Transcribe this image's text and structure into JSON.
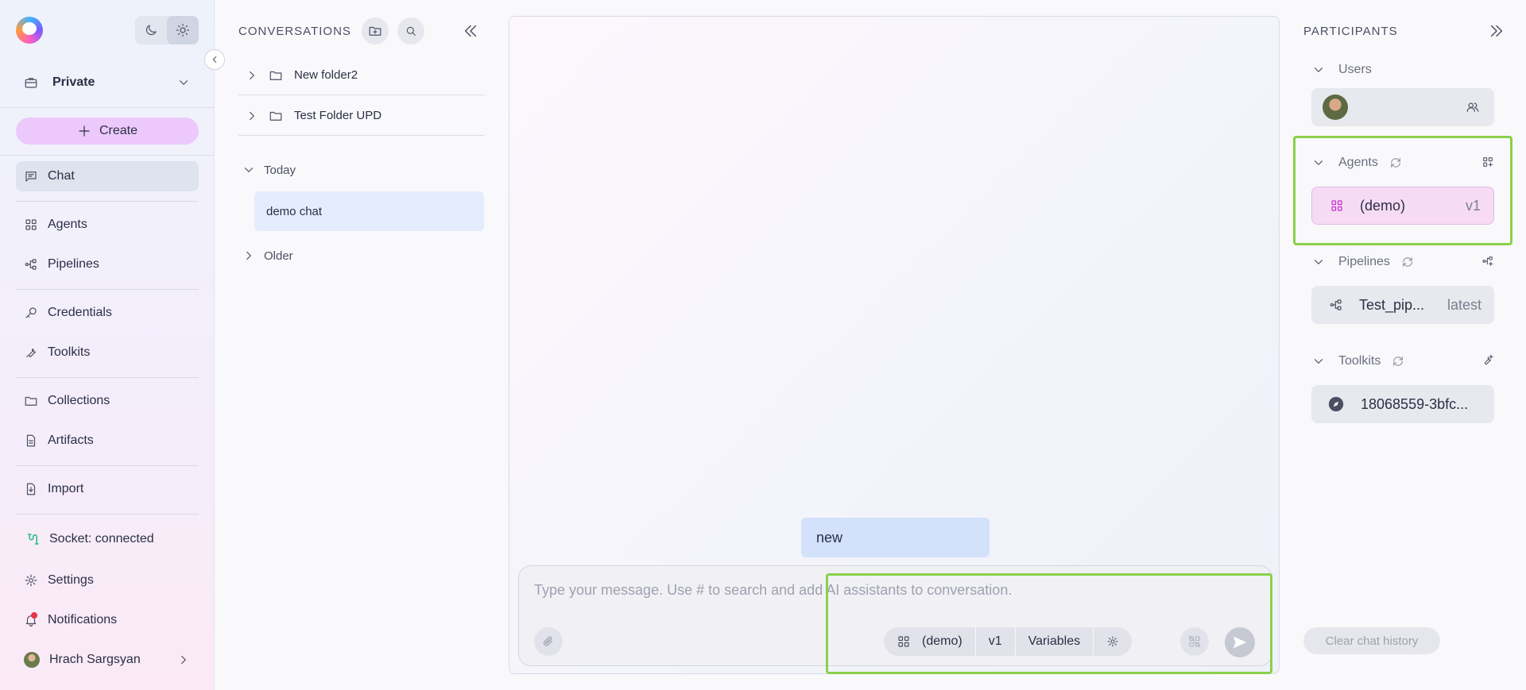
{
  "sidebar": {
    "workspace": "Private",
    "create_label": "Create",
    "items": [
      {
        "label": "Chat",
        "icon": "chat-icon"
      },
      {
        "label": "Agents",
        "icon": "agents-icon"
      },
      {
        "label": "Pipelines",
        "icon": "pipelines-icon"
      },
      {
        "label": "Credentials",
        "icon": "key-icon"
      },
      {
        "label": "Toolkits",
        "icon": "wrench-icon"
      },
      {
        "label": "Collections",
        "icon": "folder-icon"
      },
      {
        "label": "Artifacts",
        "icon": "file-icon"
      },
      {
        "label": "Import",
        "icon": "import-icon"
      }
    ],
    "socket_status": "Socket: connected",
    "settings_label": "Settings",
    "notifications_label": "Notifications",
    "user_name": "Hrach Sargsyan"
  },
  "conversations": {
    "title": "CONVERSATIONS",
    "folders": [
      "New folder2",
      "Test Folder UPD"
    ],
    "groups": [
      {
        "label": "Today",
        "expanded": true,
        "items": [
          "demo chat"
        ]
      },
      {
        "label": "Older",
        "expanded": false,
        "items": []
      }
    ]
  },
  "chat": {
    "messages": [
      {
        "text": "new"
      }
    ],
    "input_placeholder": "Type your message. Use # to search and add AI assistants to conversation.",
    "agent_name": "(demo)",
    "agent_version": "v1",
    "variables_label": "Variables"
  },
  "participants": {
    "title": "PARTICIPANTS",
    "users_label": "Users",
    "agents_label": "Agents",
    "agent": {
      "name": "(demo)",
      "version": "v1"
    },
    "pipelines_label": "Pipelines",
    "pipeline": {
      "name": "Test_pip...",
      "version": "latest"
    },
    "toolkits_label": "Toolkits",
    "toolkit": {
      "name": "18068559-3bfc..."
    },
    "clear_label": "Clear chat history"
  },
  "colors": {
    "accent_create": "#ecc9fa",
    "highlight": "#8ad04a",
    "socket": "#2fbf8f",
    "notification_dot": "#e8334a"
  }
}
